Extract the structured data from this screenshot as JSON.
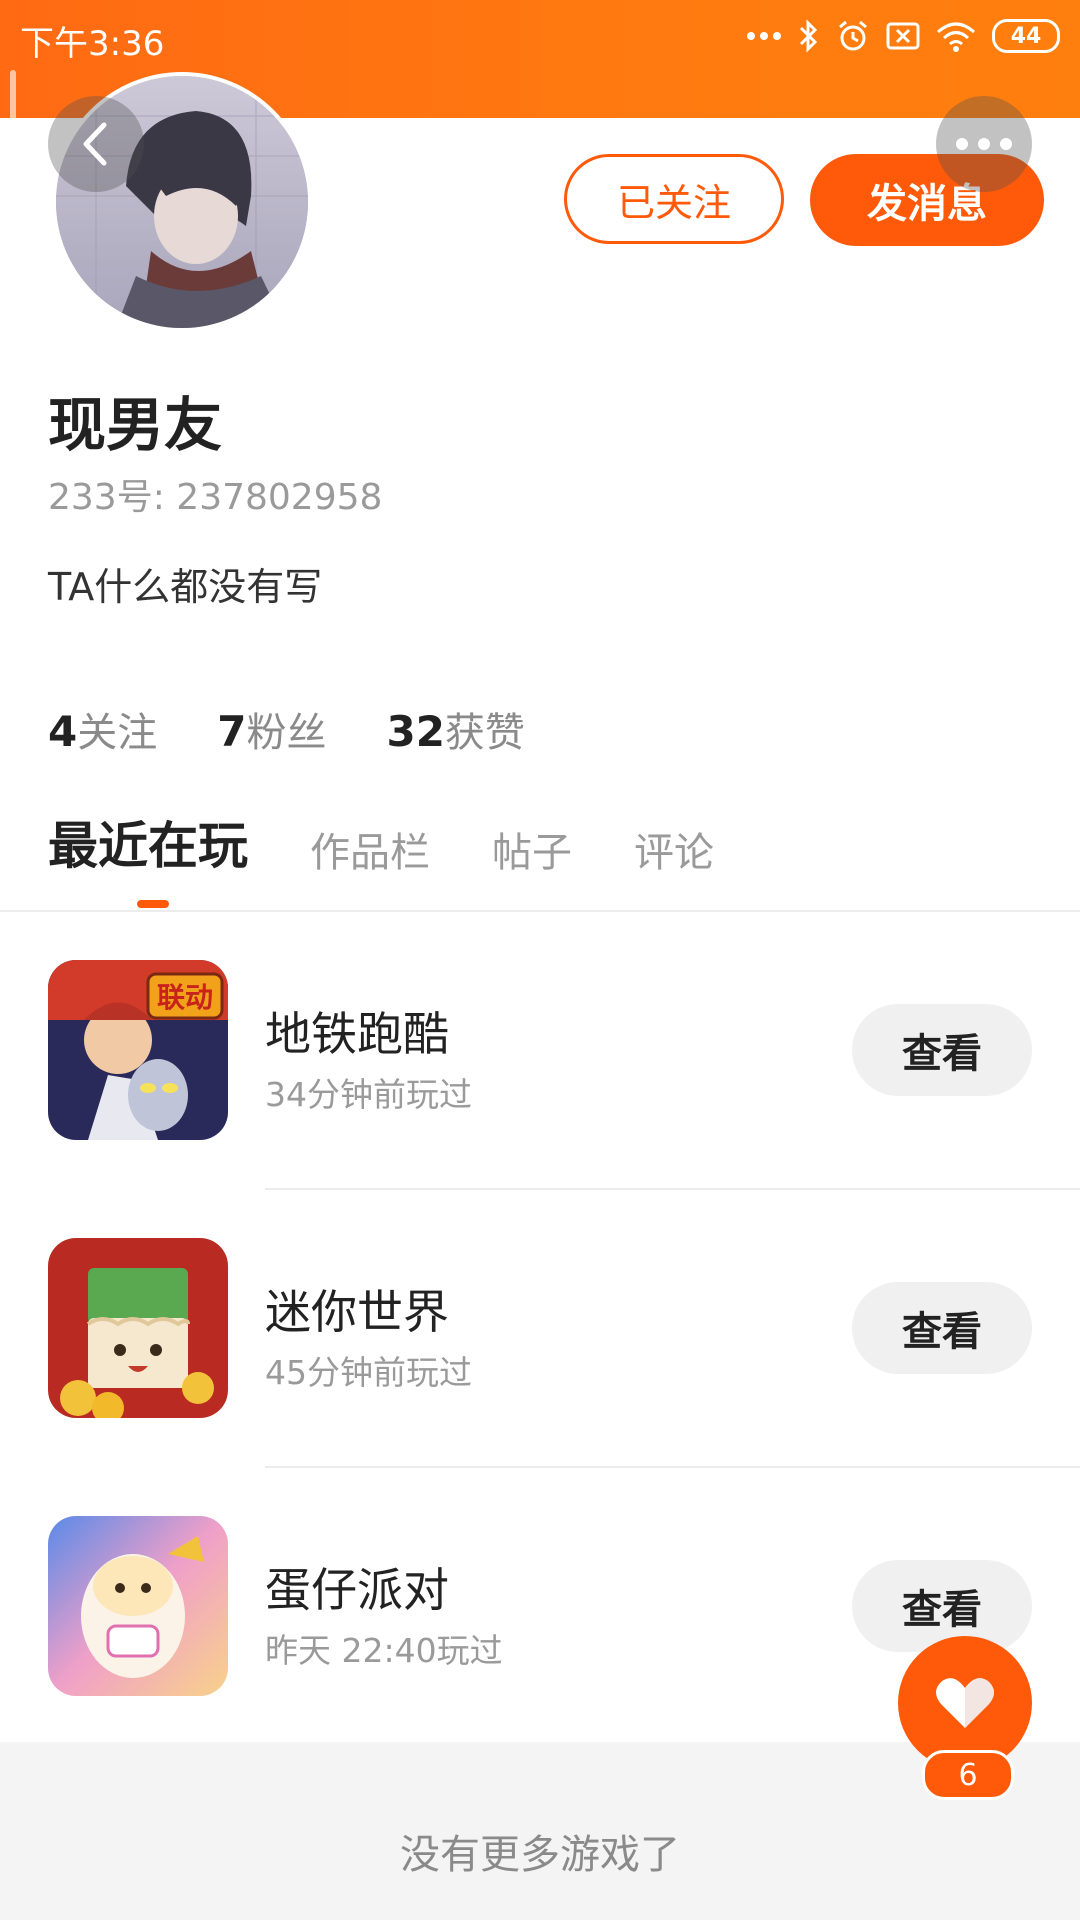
{
  "status_bar": {
    "time": "下午3:36",
    "battery": "44",
    "icons": [
      "dots-icon",
      "bluetooth-icon",
      "alarm-icon",
      "sim-icon",
      "wifi-icon",
      "battery-icon"
    ]
  },
  "profile": {
    "username": "现男友",
    "user_id": "233号: 237802958",
    "bio": "TA什么都没有写",
    "follow_button": "已关注",
    "message_button": "发消息",
    "stats": [
      {
        "num": "4",
        "label": "关注"
      },
      {
        "num": "7",
        "label": "粉丝"
      },
      {
        "num": "32",
        "label": "获赞"
      }
    ]
  },
  "tabs": [
    "最近在玩",
    "作品栏",
    "帖子",
    "评论"
  ],
  "games": [
    {
      "name": "地铁跑酷",
      "time": "34分钟前玩过",
      "button": "查看",
      "icon_text": "联动"
    },
    {
      "name": "迷你世界",
      "time": "45分钟前玩过",
      "button": "查看"
    },
    {
      "name": "蛋仔派对",
      "time": "昨天 22:40玩过",
      "button": "查看"
    }
  ],
  "footer": {
    "text": "没有更多游戏了"
  },
  "like_fab": {
    "count": "6"
  },
  "colors": {
    "accent": "#ff5a0a",
    "status_bar": "#ff7a10"
  }
}
